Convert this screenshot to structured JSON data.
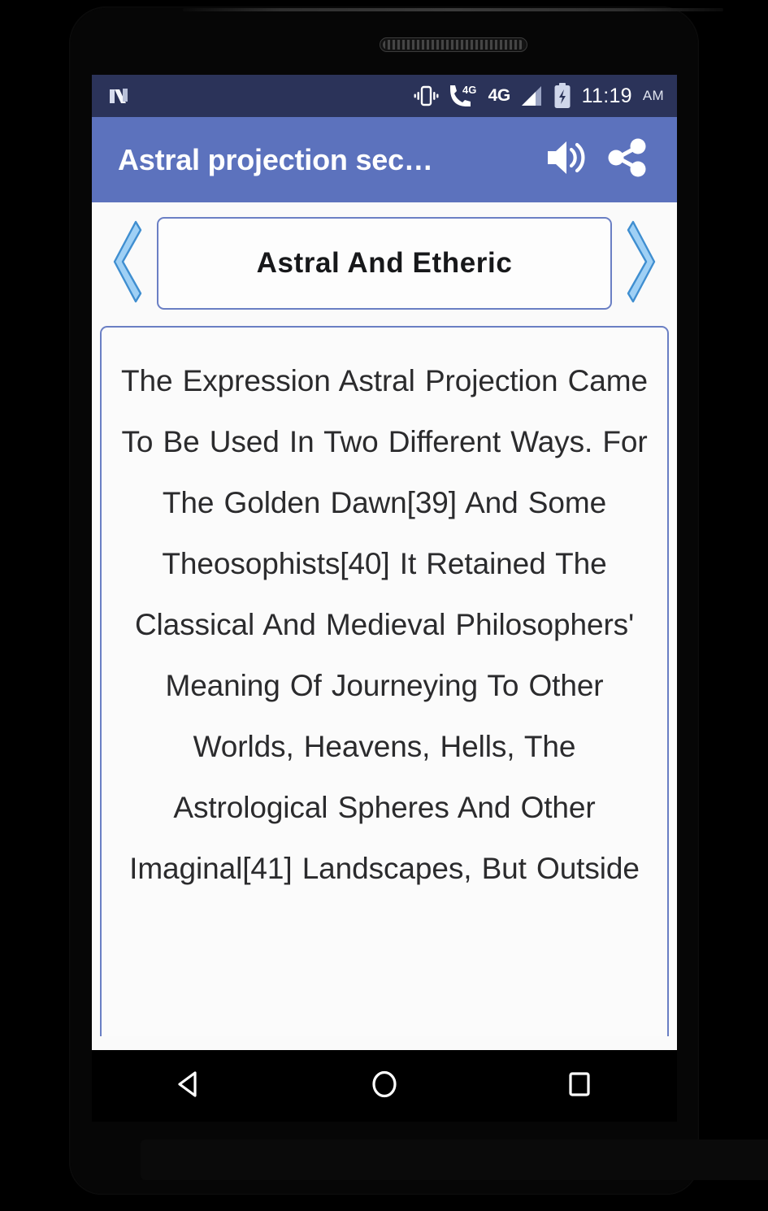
{
  "device": {
    "frame_name": "android-phone-frame",
    "earpiece_label": "earpiece-speaker"
  },
  "status_bar": {
    "os_logo": "android-nougat-n-icon",
    "icons": [
      {
        "name": "vibrate-icon",
        "label": "Vibrate"
      },
      {
        "name": "call-4g-icon",
        "label": "4G"
      },
      {
        "name": "signal-icon",
        "label": "Signal"
      },
      {
        "name": "battery-charging-icon",
        "label": "Charging"
      }
    ],
    "network_label": "4G",
    "time": "11:19",
    "time_period": "AM",
    "background_color": "#2b3359"
  },
  "app_bar": {
    "title": "Astral projection sec…",
    "speak_icon": "volume-speaker-icon",
    "share_icon": "share-icon",
    "background_color": "#5c72bd",
    "title_color": "#ffffff"
  },
  "chapter_nav": {
    "prev_icon": "chevron-left-icon",
    "next_icon": "chevron-right-icon",
    "chapter_title": "Astral  And  Etheric",
    "border_color": "#6a7fc4",
    "chevron_fill": "#9fd0f5",
    "chevron_stroke": "#3f8ed0"
  },
  "content": {
    "body_text": "The Expression  Astral Projection  Came To Be Used In Two Different Ways. For The Golden Dawn[39] And Some Theosophists[40] It Retained The Classical And Medieval Philosophers' Meaning Of Journeying To Other Worlds, Heavens, Hells, The Astrological Spheres And Other Imaginal[41] Landscapes, But Outside",
    "lines": [
      "The Expression  Astral",
      "Projection  Came To Be Used",
      "In Two Different Ways. For The",
      "Golden Dawn[39] And Some",
      "Theosophists[40] It Retained",
      "The Classical And Medieval",
      "Philosophers' Meaning Of",
      "Journeying To Other Worlds,",
      "Heavens, Hells, The Astrological",
      "Spheres And Other Imaginal[41]",
      "Landscapes, But Outside"
    ],
    "favorite_icon": "heart-outline-icon",
    "favorite_color": "#f01414",
    "text_color": "#2b2b2d",
    "card_border_color": "#6a7fc4"
  },
  "nav_bar": {
    "back_icon": "back-triangle-icon",
    "home_icon": "home-circle-icon",
    "recents_icon": "recents-square-icon",
    "background_color": "#000000"
  }
}
